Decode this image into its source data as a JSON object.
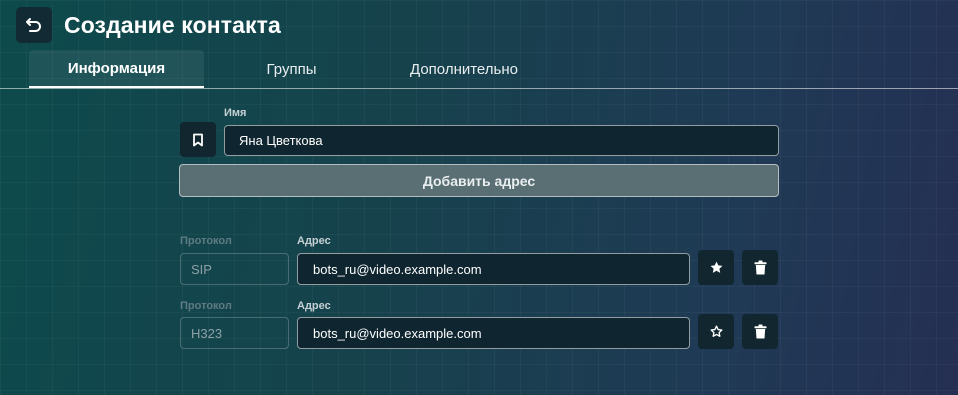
{
  "header": {
    "title": "Создание контакта",
    "back_icon": "undo-arrow-icon"
  },
  "tabs": [
    {
      "label": "Информация",
      "active": true
    },
    {
      "label": "Группы",
      "active": false
    },
    {
      "label": "Дополнительно",
      "active": false
    }
  ],
  "name_section": {
    "label": "Имя",
    "value": "Яна Цветкова",
    "bookmark_icon": "bookmark-icon"
  },
  "add_address_label": "Добавить адрес",
  "addresses": [
    {
      "protocol_label": "Протокол",
      "protocol_value": "SIP",
      "address_label": "Адрес",
      "address_value": "bots_ru@video.example.com",
      "favorite": true,
      "star_icon": "star-filled-icon",
      "delete_icon": "trash-icon"
    },
    {
      "protocol_label": "Протокол",
      "protocol_value": "H323",
      "address_label": "Адрес",
      "address_value": "bots_ru@video.example.com",
      "favorite": false,
      "star_icon": "star-outline-icon",
      "delete_icon": "trash-icon"
    }
  ],
  "colors": {
    "background_start": "#0d4a4c",
    "background_end": "#252f52",
    "button_dark": "#11262e",
    "add_button": "#5a6f73"
  }
}
